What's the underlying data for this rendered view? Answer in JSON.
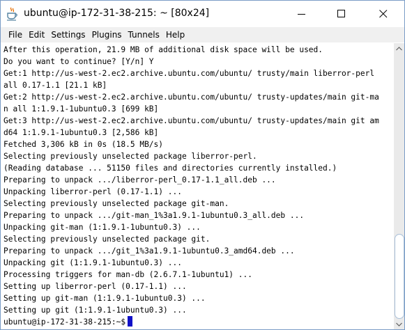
{
  "window": {
    "title": "ubuntu@ip-172-31-38-215: ~ [80x24]"
  },
  "menu": {
    "items": [
      "File",
      "Edit",
      "Settings",
      "Plugins",
      "Tunnels",
      "Help"
    ]
  },
  "terminal": {
    "lines": [
      "After this operation, 21.9 MB of additional disk space will be used.",
      "Do you want to continue? [Y/n] Y",
      "Get:1 http://us-west-2.ec2.archive.ubuntu.com/ubuntu/ trusty/main liberror-perl",
      "all 0.17-1.1 [21.1 kB]",
      "Get:2 http://us-west-2.ec2.archive.ubuntu.com/ubuntu/ trusty-updates/main git-ma",
      "n all 1:1.9.1-1ubuntu0.3 [699 kB]",
      "Get:3 http://us-west-2.ec2.archive.ubuntu.com/ubuntu/ trusty-updates/main git am",
      "d64 1:1.9.1-1ubuntu0.3 [2,586 kB]",
      "Fetched 3,306 kB in 0s (18.5 MB/s)",
      "Selecting previously unselected package liberror-perl.",
      "(Reading database ... 51150 files and directories currently installed.)",
      "Preparing to unpack .../liberror-perl_0.17-1.1_all.deb ...",
      "Unpacking liberror-perl (0.17-1.1) ...",
      "Selecting previously unselected package git-man.",
      "Preparing to unpack .../git-man_1%3a1.9.1-1ubuntu0.3_all.deb ...",
      "Unpacking git-man (1:1.9.1-1ubuntu0.3) ...",
      "Selecting previously unselected package git.",
      "Preparing to unpack .../git_1%3a1.9.1-1ubuntu0.3_amd64.deb ...",
      "Unpacking git (1:1.9.1-1ubuntu0.3) ...",
      "Processing triggers for man-db (2.6.7.1-1ubuntu1) ...",
      "Setting up liberror-perl (0.17-1.1) ...",
      "Setting up git-man (1:1.9.1-1ubuntu0.3) ...",
      "Setting up git (1:1.9.1-1ubuntu0.3) ..."
    ],
    "prompt": "ubuntu@ip-172-31-38-215:~$"
  },
  "icons": {
    "app": "java-coffee-cup-icon",
    "minimize": "minimize-icon",
    "maximize": "maximize-icon",
    "close": "close-icon",
    "scroll_up": "chevron-up-icon",
    "scroll_down": "chevron-down-icon"
  },
  "colors": {
    "cursor": "#1010c8",
    "menubar": "#f0f0f0",
    "window_border": "#7a9cc7"
  }
}
